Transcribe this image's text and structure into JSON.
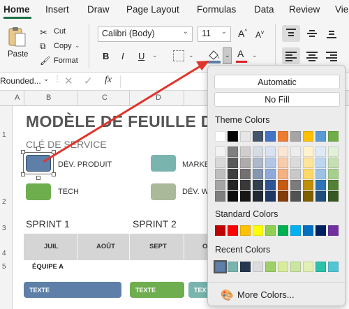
{
  "ribbon_tabs": [
    "Home",
    "Insert",
    "Draw",
    "Page Layout",
    "Formulas",
    "Data",
    "Review",
    "Vie"
  ],
  "clipboard": {
    "paste": "Paste",
    "cut": "Cut",
    "copy": "Copy",
    "format": "Format"
  },
  "font": {
    "name": "Calibri (Body)",
    "size": "11"
  },
  "format_buttons": {
    "bold": "B",
    "italic": "I",
    "underline": "U",
    "fill_letter": "A"
  },
  "name_box": "Rounded...",
  "formula_fx": "fx",
  "column_headers": [
    "A",
    "B",
    "C",
    "D"
  ],
  "row_headers": [
    "1",
    "2",
    "3",
    "4",
    "5"
  ],
  "sheet": {
    "title": "MODÈLE DE FEUILLE DE RO",
    "cle": "CLÉ DE SERVICE",
    "legend": [
      {
        "label": "DÉV. PRODUIT",
        "color": "#5e80a8"
      },
      {
        "label": "MARKE",
        "color": "#7ab4ae"
      },
      {
        "label": "TECH",
        "color": "#6fae4f"
      },
      {
        "label": "DÉV. W",
        "color": "#a9b99a"
      }
    ],
    "sprints": [
      "SPRINT 1",
      "SPRINT 2"
    ],
    "months": [
      "JUIL",
      "AOÛT",
      "SEPT",
      "O"
    ],
    "equipe": "ÉQUIPE A",
    "bars": [
      {
        "label": "TEXTE",
        "color": "#5e80a8"
      },
      {
        "label": "TEXTE",
        "color": "#6fae4f"
      },
      {
        "label": "TEXTE",
        "color": "#7ab4ae"
      }
    ]
  },
  "fill_popup": {
    "automatic": "Automatic",
    "no_fill": "No Fill",
    "theme_title": "Theme Colors",
    "theme_top": [
      "#ffffff",
      "#000000",
      "#e7e6e6",
      "#44546a",
      "#4472c4",
      "#ed7d31",
      "#a5a5a5",
      "#ffc000",
      "#5b9bd5",
      "#70ad47"
    ],
    "theme_shades": [
      [
        "#f2f2f2",
        "#7f7f7f",
        "#d0cece",
        "#d6dce4",
        "#d9e2f3",
        "#fbe5d5",
        "#ededed",
        "#fff2cc",
        "#deebf6",
        "#e2efd9"
      ],
      [
        "#d8d8d8",
        "#595959",
        "#aeabab",
        "#adb9ca",
        "#b4c6e7",
        "#f7cbac",
        "#dbdbdb",
        "#fee599",
        "#bdd7ee",
        "#c5e0b3"
      ],
      [
        "#bfbfbf",
        "#3f3f3f",
        "#757070",
        "#8496b0",
        "#8eaadb",
        "#f4b183",
        "#c9c9c9",
        "#ffd965",
        "#9cc3e5",
        "#a8d08d"
      ],
      [
        "#a5a5a5",
        "#262626",
        "#3a3838",
        "#323f4f",
        "#2f5496",
        "#c55a11",
        "#7b7b7b",
        "#bf8f00",
        "#2e75b5",
        "#538135"
      ],
      [
        "#7f7f7f",
        "#0c0c0c",
        "#171616",
        "#222a35",
        "#1f3864",
        "#833c0b",
        "#525252",
        "#7f6000",
        "#1e4e79",
        "#375623"
      ]
    ],
    "standard_title": "Standard Colors",
    "standard": [
      "#c00000",
      "#ff0000",
      "#ffc000",
      "#ffff00",
      "#92d050",
      "#00b050",
      "#00b0f0",
      "#0070c0",
      "#002060",
      "#7030a0"
    ],
    "recent_title": "Recent Colors",
    "recent": [
      "#5e80a8",
      "#7ab4ae",
      "#26374f",
      "#dcdcdc",
      "#9fcf68",
      "#d9ec9d",
      "#c9e59f",
      "#e2f0b3",
      "#2cc2a8",
      "#52c4d4"
    ],
    "more": "More Colors..."
  },
  "colors": {
    "excel_green": "#1e7145",
    "arrow": "#e0352b"
  }
}
